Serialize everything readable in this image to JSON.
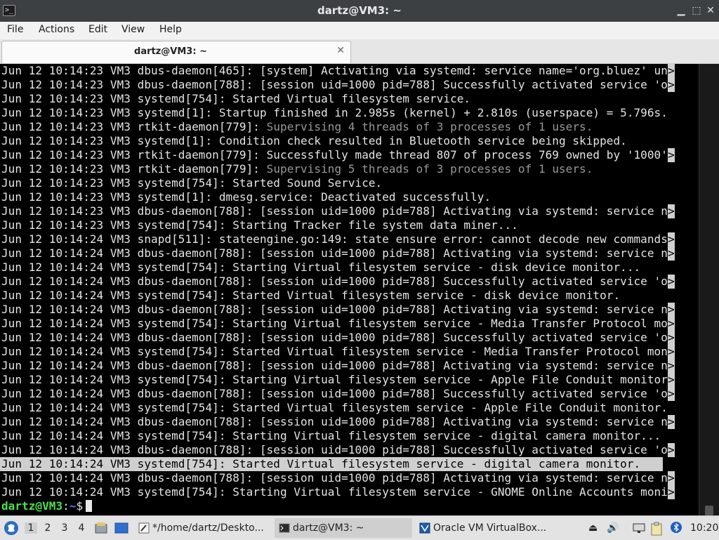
{
  "window": {
    "title": "dartz@VM3: ~",
    "buttons": {
      "minimize": "▁",
      "maximize": "⬚",
      "close": "✕"
    }
  },
  "menu": [
    "File",
    "Actions",
    "Edit",
    "View",
    "Help"
  ],
  "tab": {
    "title": "dartz@VM3: ~",
    "close": "✕"
  },
  "terminal": {
    "lines": [
      {
        "text": "Jun 12 10:14:23 VM3 dbus-daemon[465]: [system] Activating via systemd: service name='org.bluez' un",
        "more": true
      },
      {
        "text": "Jun 12 10:14:23 VM3 dbus-daemon[788]: [session uid=1000 pid=788] Successfully activated service 'o",
        "more": true
      },
      {
        "text": "Jun 12 10:14:23 VM3 systemd[754]: Started Virtual filesystem service."
      },
      {
        "text": "Jun 12 10:14:23 VM3 systemd[1]: Startup finished in 2.985s (kernel) + 2.810s (userspace) = 5.796s."
      },
      {
        "prefix": "Jun 12 10:14:23 VM3 rtkit-daemon[779]: ",
        "dim": "Supervising 4 threads of 3 processes of 1 users."
      },
      {
        "text": "Jun 12 10:14:23 VM3 systemd[1]: Condition check resulted in Bluetooth service being skipped."
      },
      {
        "text": "Jun 12 10:14:23 VM3 rtkit-daemon[779]: Successfully made thread 807 of process 769 owned by '1000'",
        "more": true
      },
      {
        "prefix": "Jun 12 10:14:23 VM3 rtkit-daemon[779]: ",
        "dim": "Supervising 5 threads of 3 processes of 1 users."
      },
      {
        "text": "Jun 12 10:14:23 VM3 systemd[754]: Started Sound Service."
      },
      {
        "text": "Jun 12 10:14:23 VM3 systemd[1]: dmesg.service: Deactivated successfully."
      },
      {
        "text": "Jun 12 10:14:23 VM3 dbus-daemon[788]: [session uid=1000 pid=788] Activating via systemd: service n",
        "more": true
      },
      {
        "text": "Jun 12 10:14:23 VM3 systemd[754]: Starting Tracker file system data miner..."
      },
      {
        "text": "Jun 12 10:14:24 VM3 snapd[511]: stateengine.go:149: state ensure error: cannot decode new commands",
        "more": true
      },
      {
        "text": "Jun 12 10:14:24 VM3 dbus-daemon[788]: [session uid=1000 pid=788] Activating via systemd: service n",
        "more": true
      },
      {
        "text": "Jun 12 10:14:24 VM3 systemd[754]: Starting Virtual filesystem service - disk device monitor..."
      },
      {
        "text": "Jun 12 10:14:24 VM3 dbus-daemon[788]: [session uid=1000 pid=788] Successfully activated service 'o",
        "more": true
      },
      {
        "text": "Jun 12 10:14:24 VM3 systemd[754]: Started Virtual filesystem service - disk device monitor."
      },
      {
        "text": "Jun 12 10:14:24 VM3 dbus-daemon[788]: [session uid=1000 pid=788] Activating via systemd: service n",
        "more": true
      },
      {
        "text": "Jun 12 10:14:24 VM3 systemd[754]: Starting Virtual filesystem service - Media Transfer Protocol mo",
        "more": true
      },
      {
        "text": "Jun 12 10:14:24 VM3 dbus-daemon[788]: [session uid=1000 pid=788] Successfully activated service 'o",
        "more": true
      },
      {
        "text": "Jun 12 10:14:24 VM3 systemd[754]: Started Virtual filesystem service - Media Transfer Protocol mon",
        "more": true
      },
      {
        "text": "Jun 12 10:14:24 VM3 dbus-daemon[788]: [session uid=1000 pid=788] Activating via systemd: service n",
        "more": true
      },
      {
        "text": "Jun 12 10:14:24 VM3 systemd[754]: Starting Virtual filesystem service - Apple File Conduit monitor",
        "more": true
      },
      {
        "text": "Jun 12 10:14:24 VM3 dbus-daemon[788]: [session uid=1000 pid=788] Successfully activated service 'o",
        "more": true
      },
      {
        "text": "Jun 12 10:14:24 VM3 systemd[754]: Started Virtual filesystem service - Apple File Conduit monitor."
      },
      {
        "text": "Jun 12 10:14:24 VM3 dbus-daemon[788]: [session uid=1000 pid=788] Activating via systemd: service n",
        "more": true
      },
      {
        "text": "Jun 12 10:14:24 VM3 systemd[754]: Starting Virtual filesystem service - digital camera monitor..."
      },
      {
        "text": "Jun 12 10:14:24 VM3 dbus-daemon[788]: [session uid=1000 pid=788] Successfully activated service 'o",
        "more": true
      },
      {
        "text": "Jun 12 10:14:24 VM3 systemd[754]: Started Virtual filesystem service - digital camera monitor.",
        "selected": true
      },
      {
        "text": "Jun 12 10:14:24 VM3 dbus-daemon[788]: [session uid=1000 pid=788] Activating via systemd: service n",
        "more": true
      },
      {
        "text": "Jun 12 10:14:24 VM3 systemd[754]: Starting Virtual filesystem service - GNOME Online Accounts moni",
        "more": true
      }
    ],
    "overflow_marker": ">",
    "prompt": {
      "user_host": "dartz@VM3",
      "sep": ":",
      "path": "~",
      "symbol": "$"
    }
  },
  "taskbar": {
    "workspaces": [
      "1",
      "2",
      "3",
      "4"
    ],
    "tasks": [
      {
        "label": "*/home/dartz/Deskto...",
        "icon": "text-editor-icon"
      },
      {
        "label": "dartz@VM3: ~",
        "icon": "terminal-icon"
      },
      {
        "label": "Oracle VM VirtualBox...",
        "icon": "virtualbox-icon"
      }
    ],
    "clock": "10:20"
  },
  "colors": {
    "titlebar": "#3c4043",
    "prompt_user": "#4be34b",
    "prompt_path": "#5c7cff",
    "selection": "#cfcfcf"
  }
}
